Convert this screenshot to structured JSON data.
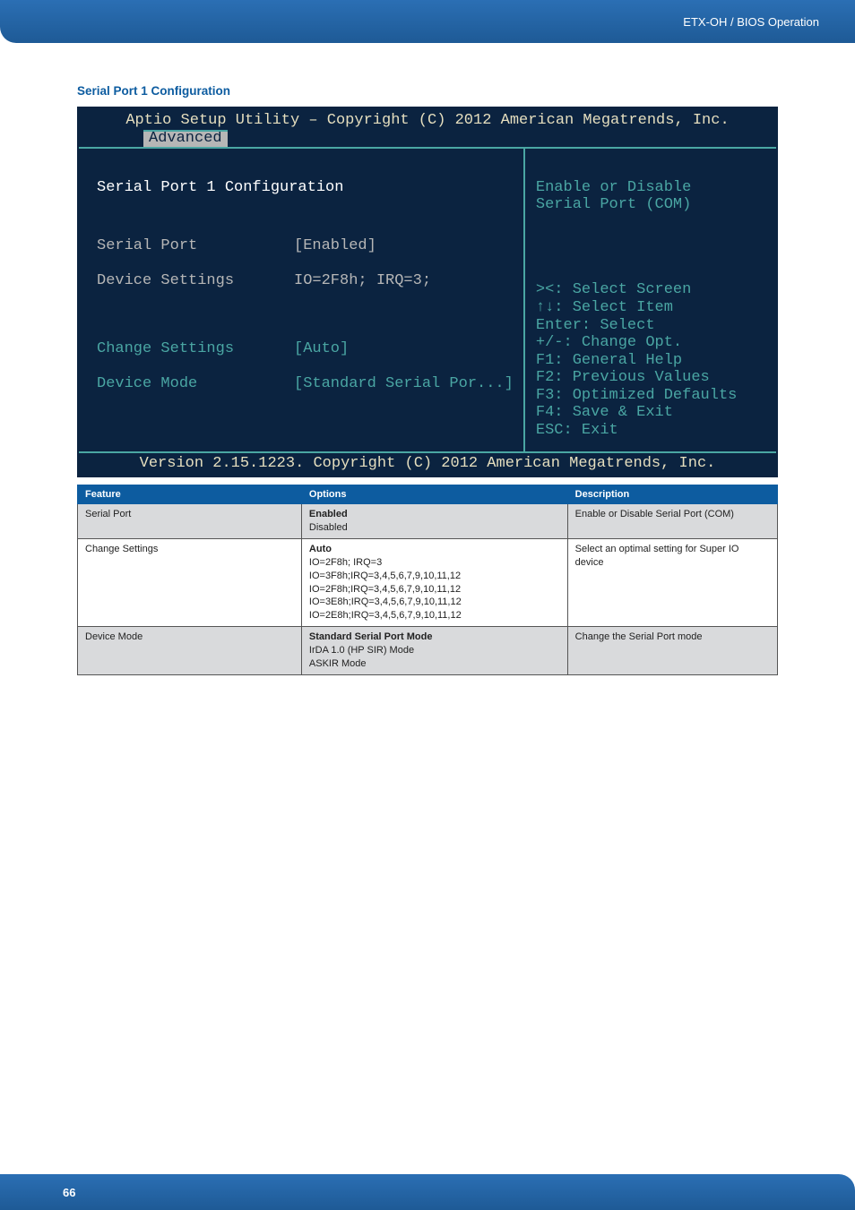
{
  "header": {
    "doc_title": "ETX-OH / BIOS Operation"
  },
  "section": {
    "title": "Serial Port 1 Configuration"
  },
  "bios": {
    "title": "Aptio Setup Utility – Copyright (C) 2012 American Megatrends, Inc.",
    "tab": "Advanced",
    "heading": "Serial Port 1 Configuration",
    "items": {
      "serial_port_label": "Serial Port",
      "serial_port_value": "[Enabled]",
      "device_settings_label": "Device Settings",
      "device_settings_value": "IO=2F8h; IRQ=3;",
      "change_settings_label": "Change Settings",
      "change_settings_value": "[Auto]",
      "device_mode_label": "Device Mode",
      "device_mode_value": "[Standard Serial Por...]"
    },
    "help_top_line1": "Enable or Disable",
    "help_top_line2": "Serial Port (COM)",
    "nav": {
      "l1": "><: Select Screen",
      "l2": "↑↓: Select Item",
      "l3": "Enter: Select",
      "l4": "+/-: Change Opt.",
      "l5": "F1: General Help",
      "l6": "F2: Previous Values",
      "l7": "F3: Optimized Defaults",
      "l8": "F4: Save & Exit",
      "l9": "ESC: Exit"
    },
    "version": "Version 2.15.1223. Copyright (C) 2012 American Megatrends, Inc."
  },
  "table": {
    "headers": {
      "feature": "Feature",
      "options": "Options",
      "description": "Description"
    },
    "rows": [
      {
        "feature": "Serial Port",
        "options_bold": "Enabled",
        "options_rest": "Disabled",
        "description": "Enable or Disable Serial Port (COM)"
      },
      {
        "feature": "Change Settings",
        "options_bold": "Auto",
        "options_rest": "IO=2F8h; IRQ=3\nIO=3F8h;IRQ=3,4,5,6,7,9,10,11,12\nIO=2F8h;IRQ=3,4,5,6,7,9,10,11,12\nIO=3E8h;IRQ=3,4,5,6,7,9,10,11,12\nIO=2E8h;IRQ=3,4,5,6,7,9,10,11,12",
        "description": "Select an optimal setting for Super IO device"
      },
      {
        "feature": "Device Mode",
        "options_bold": "Standard Serial Port Mode",
        "options_rest": "IrDA 1.0 (HP SIR) Mode\nASKIR Mode",
        "description": "Change the Serial Port mode"
      }
    ]
  },
  "footer": {
    "page_number": "66"
  }
}
